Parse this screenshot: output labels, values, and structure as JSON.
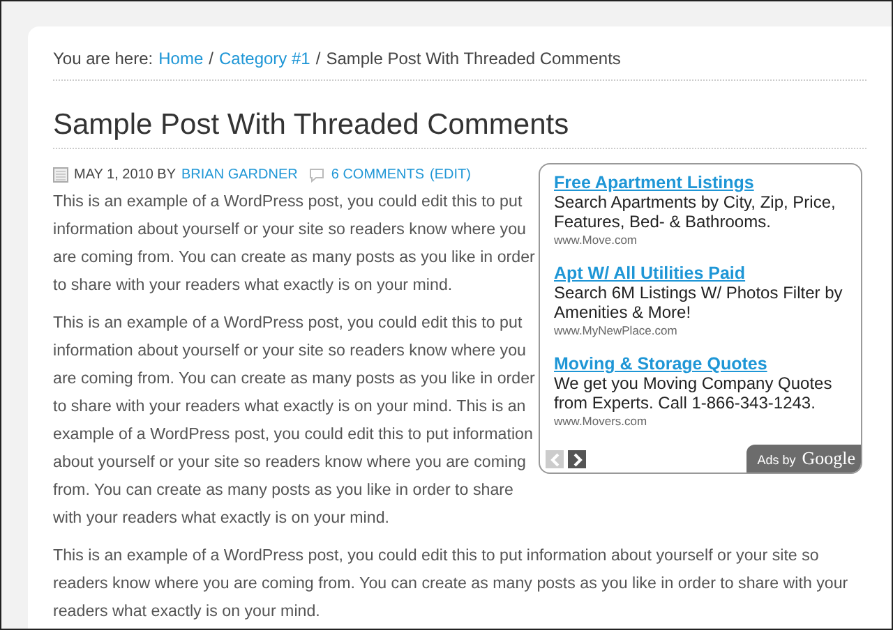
{
  "breadcrumb": {
    "prefix": "You are here:",
    "separator": "/",
    "items": [
      {
        "label": "Home",
        "kind": "link"
      },
      {
        "label": "Category #1",
        "kind": "link"
      },
      {
        "label": "Sample Post With Threaded Comments",
        "kind": "current"
      }
    ]
  },
  "post": {
    "title": "Sample Post With Threaded Comments",
    "meta": {
      "date_by": "MAY 1, 2010 BY",
      "author": "BRIAN GARDNER",
      "comments": "6 COMMENTS",
      "edit": "(EDIT)"
    },
    "paragraphs": [
      "This is an example of a WordPress post, you could edit this to put information about yourself or your site so readers know where you are coming from. You can create as many posts as you like in order to share with your readers what exactly is on your mind.",
      "This is an example of a WordPress post, you could edit this to put information about yourself or your site so readers know where you are coming from. You can create as many posts as you like in order to share with your readers what exactly is on your mind. This is an example of a WordPress post, you could edit this to put information about yourself or your site so readers know where you are coming from. You can create as many posts as you like in order to share with your readers what exactly is on your mind.",
      "This is an example of a WordPress post, you could edit this to put information about yourself or your site so readers know where you are coming from. You can create as many posts as you like in order to share with your readers what exactly is on your mind."
    ]
  },
  "ads": {
    "items": [
      {
        "title": "Free Apartment Listings",
        "text": "Search Apartments by City, Zip, Price, Features, Bed- & Bathrooms.",
        "url": "www.Move.com"
      },
      {
        "title": "Apt W/ All Utilities Paid",
        "text": "Search 6M Listings W/ Photos Filter by Amenities & More!",
        "url": "www.MyNewPlace.com"
      },
      {
        "title": "Moving & Storage Quotes",
        "text": "We get you Moving Company Quotes from Experts. Call 1-866-343-1243.",
        "url": "www.Movers.com"
      }
    ],
    "nav": [
      {
        "kind": "prev",
        "disabled": true
      },
      {
        "kind": "next",
        "disabled": false
      }
    ],
    "badge": {
      "prefix": "Ads by",
      "brand": "Google"
    }
  }
}
